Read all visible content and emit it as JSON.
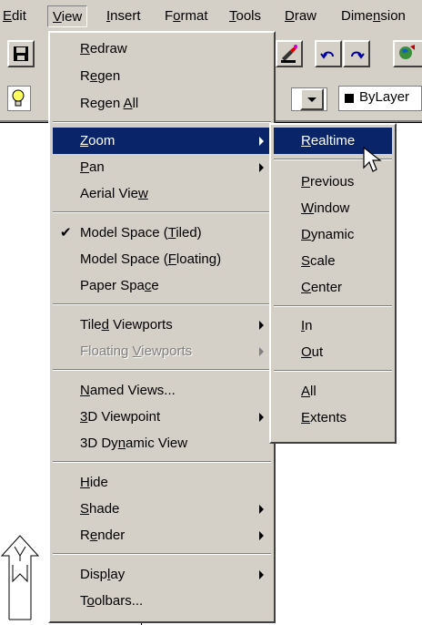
{
  "menubar": {
    "items": [
      {
        "pre": "",
        "u": "E",
        "post": "dit"
      },
      {
        "pre": "",
        "u": "V",
        "post": "iew"
      },
      {
        "pre": "",
        "u": "I",
        "post": "nsert"
      },
      {
        "pre": "F",
        "u": "o",
        "post": "rmat"
      },
      {
        "pre": "",
        "u": "T",
        "post": "ools"
      },
      {
        "pre": "",
        "u": "D",
        "post": "raw"
      },
      {
        "pre": "Dime",
        "u": "n",
        "post": "sion"
      }
    ]
  },
  "layer": {
    "color_label": "ByLayer"
  },
  "view_menu": {
    "items": [
      {
        "pre": "",
        "u": "R",
        "post": "edraw"
      },
      {
        "pre": "R",
        "u": "e",
        "post": "gen"
      },
      {
        "pre": "Regen ",
        "u": "A",
        "post": "ll"
      },
      {
        "pre": "",
        "u": "Z",
        "post": "oom"
      },
      {
        "pre": "",
        "u": "P",
        "post": "an"
      },
      {
        "pre": "Aerial Vie",
        "u": "w",
        "post": ""
      },
      {
        "pre": "Model Space (",
        "u": "T",
        "post": "iled)"
      },
      {
        "pre": "Model Space (",
        "u": "F",
        "post": "loating)"
      },
      {
        "pre": "Paper Spa",
        "u": "c",
        "post": "e"
      },
      {
        "pre": "Tile",
        "u": "d",
        "post": " Viewports"
      },
      {
        "pre": "Floating ",
        "u": "V",
        "post": "iewports"
      },
      {
        "pre": "",
        "u": "N",
        "post": "amed Views..."
      },
      {
        "pre": "",
        "u": "3",
        "post": "D Viewpoint"
      },
      {
        "pre": "3D Dy",
        "u": "n",
        "post": "amic View"
      },
      {
        "pre": "",
        "u": "H",
        "post": "ide"
      },
      {
        "pre": "",
        "u": "S",
        "post": "hade"
      },
      {
        "pre": "R",
        "u": "e",
        "post": "nder"
      },
      {
        "pre": "Disp",
        "u": "l",
        "post": "ay"
      },
      {
        "pre": "T",
        "u": "o",
        "post": "olbars..."
      }
    ],
    "check_mark": "✔"
  },
  "zoom_menu": {
    "items": [
      {
        "pre": "",
        "u": "R",
        "post": "ealtime"
      },
      {
        "pre": "",
        "u": "P",
        "post": "revious"
      },
      {
        "pre": "",
        "u": "W",
        "post": "indow"
      },
      {
        "pre": "",
        "u": "D",
        "post": "ynamic"
      },
      {
        "pre": "",
        "u": "S",
        "post": "cale"
      },
      {
        "pre": "",
        "u": "C",
        "post": "enter"
      },
      {
        "pre": "",
        "u": "I",
        "post": "n"
      },
      {
        "pre": "",
        "u": "O",
        "post": "ut"
      },
      {
        "pre": "",
        "u": "A",
        "post": "ll"
      },
      {
        "pre": "",
        "u": "E",
        "post": "xtents"
      }
    ]
  },
  "icons": [
    "save-icon",
    "bulb-icon",
    "paint-icon",
    "undo-icon",
    "redo-icon",
    "globe-icon",
    "cursor-icon",
    "ucs-icon"
  ],
  "colors": {
    "highlight": "#0a246a",
    "face": "#d4d0c8"
  }
}
